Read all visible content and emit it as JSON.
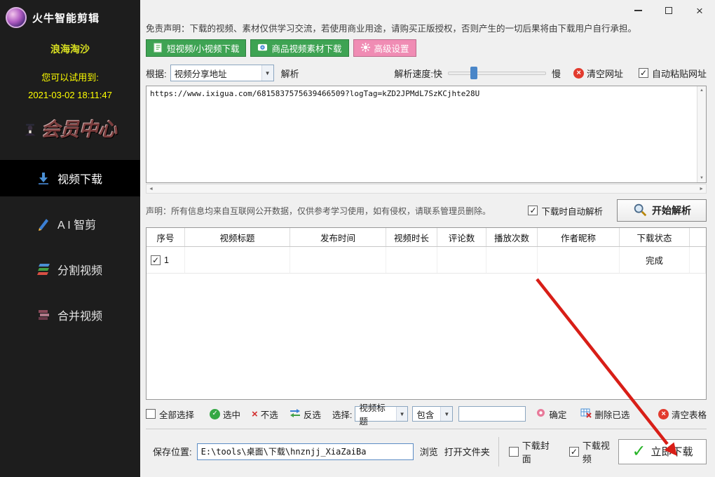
{
  "colors": {
    "sidebar_bg": "#1d1d1d",
    "accent_green": "#3ea353",
    "accent_pink": "#f08cb4",
    "highlight_yellow": "#ffff00",
    "arrow_red": "#d81e17",
    "slider_thumb_blue": "#4a86c8"
  },
  "icons": {
    "close_window": "×",
    "checkmark": "✓",
    "cross": "×",
    "dropdown_arrow": "▼",
    "scroll_left": "◄",
    "scroll_right": "►",
    "scroll_up": "▲",
    "scroll_down": "▼",
    "big_check": "✓"
  },
  "sidebar": {
    "app_title": "火牛智能剪辑",
    "username": "浪海淘沙",
    "trial_label": "您可以试用到:",
    "trial_date": "2021-03-02 18:11:47",
    "member_center": "会员中心",
    "nav": [
      {
        "label": "视频下载"
      },
      {
        "label": "A I 智剪"
      },
      {
        "label": "分割视频"
      },
      {
        "label": "合并视频"
      }
    ]
  },
  "main": {
    "disclaimer": "免责声明：下载的视频、素材仅供学习交流，若使用商业用途，请购买正版授权，否则产生的一切后果将由下载用户自行承担。",
    "buttons": {
      "short_video": "短视频/小视频下载",
      "product_video": "商品视频素材下载",
      "advanced": "高级设置"
    },
    "parse": {
      "basis_label": "根据:",
      "source": "视频分享地址",
      "parse_label": "解析",
      "speed_label": "解析速度:快",
      "slow_label": "慢",
      "clear_url": "清空网址",
      "auto_paste": "自动粘贴网址"
    },
    "url": "https://www.ixigua.com/6815837575639466509?logTag=kZD2JPMdL7SzKCjhte28U",
    "statement": "声明：所有信息均来自互联网公开数据，仅供参考学习使用，如有侵权，请联系管理员删除。",
    "auto_parse_on_download": "下载时自动解析",
    "start_parse": "开始解析",
    "table": {
      "headers": [
        "序号",
        "视频标题",
        "发布时间",
        "视频时长",
        "评论数",
        "播放次数",
        "作者昵称",
        "下载状态"
      ],
      "rows": [
        {
          "index": "1",
          "title": "",
          "publish_time": "",
          "duration": "",
          "comments": "",
          "plays": "",
          "author": "",
          "status": "完成"
        }
      ]
    },
    "selection": {
      "select_all": "全部选择",
      "select": "选中",
      "deselect": "不选",
      "invert": "反选",
      "filter_label": "选择:",
      "field": "视频标题",
      "operator": "包含",
      "confirm": "确定",
      "delete_selected": "删除已选",
      "clear_table": "清空表格"
    },
    "save": {
      "label": "保存位置:",
      "path": "E:\\tools\\桌面\\下载\\hnznjj_XiaZaiBa",
      "browse": "浏览",
      "open_folder": "打开文件夹",
      "cover": "下载封面",
      "video": "下载视频",
      "download": "立即下载"
    }
  }
}
